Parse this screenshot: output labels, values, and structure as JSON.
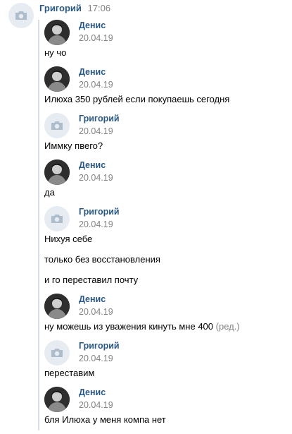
{
  "outer": {
    "author": "Григорий",
    "time": "17:06"
  },
  "messages": [
    {
      "author": "Денис",
      "date": "20.04.19",
      "avatar": "photo-avatar",
      "lines": [
        "ну чо"
      ]
    },
    {
      "author": "Денис",
      "date": "20.04.19",
      "avatar": "photo-avatar",
      "lines": [
        "Илюха 350 рублей если покупаешь сегодня"
      ]
    },
    {
      "author": "Григорий",
      "date": "20.04.19",
      "avatar": "camera-icon",
      "lines": [
        "Иммку пвего?"
      ]
    },
    {
      "author": "Денис",
      "date": "20.04.19",
      "avatar": "photo-avatar",
      "lines": [
        "да"
      ]
    },
    {
      "author": "Григорий",
      "date": "20.04.19",
      "avatar": "camera-icon",
      "lines": [
        "Нихуя себе",
        "только без восстановления",
        "и го переставил почту"
      ]
    },
    {
      "author": "Денис",
      "date": "20.04.19",
      "avatar": "photo-avatar",
      "lines": [
        "ну можешь из уважения кинуть мне 400"
      ],
      "edited": "(ред.)"
    },
    {
      "author": "Григорий",
      "date": "20.04.19",
      "avatar": "camera-icon",
      "lines": [
        "переставим"
      ]
    },
    {
      "author": "Денис",
      "date": "20.04.19",
      "avatar": "photo-avatar",
      "lines": [
        "бля Илюха у меня компа нет"
      ]
    }
  ],
  "colors": {
    "link": "#2a5885",
    "muted": "#828282",
    "divider": "#d7dee6",
    "avatar_bg": "#e6ecf1"
  }
}
